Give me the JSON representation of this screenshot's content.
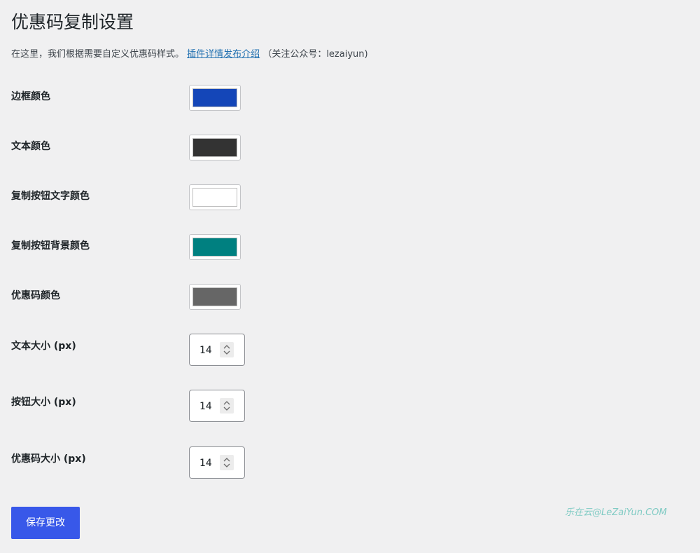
{
  "page": {
    "title": "优惠码复制设置",
    "intro_text": "在这里，我们根据需要自定义优惠码样式。",
    "intro_link": "插件详情发布介绍",
    "intro_note": "（关注公众号：lezaiyun)"
  },
  "color_settings": [
    {
      "label": "边框颜色",
      "color": "#1446b8"
    },
    {
      "label": "文本颜色",
      "color": "#333333"
    },
    {
      "label": "复制按钮文字颜色",
      "color": "#ffffff"
    },
    {
      "label": "复制按钮背景颜色",
      "color": "#008080"
    },
    {
      "label": "优惠码颜色",
      "color": "#666666"
    }
  ],
  "size_settings": [
    {
      "label": "文本大小 (px)",
      "value": "14"
    },
    {
      "label": "按钮大小 (px)",
      "value": "14"
    },
    {
      "label": "优惠码大小 (px)",
      "value": "14"
    }
  ],
  "save_button": {
    "label": "保存更改",
    "color": "#3858e9"
  },
  "watermark": "乐在云@LeZaiYun.COM",
  "icons": {
    "spinner": "up-down-chevron-icon"
  }
}
